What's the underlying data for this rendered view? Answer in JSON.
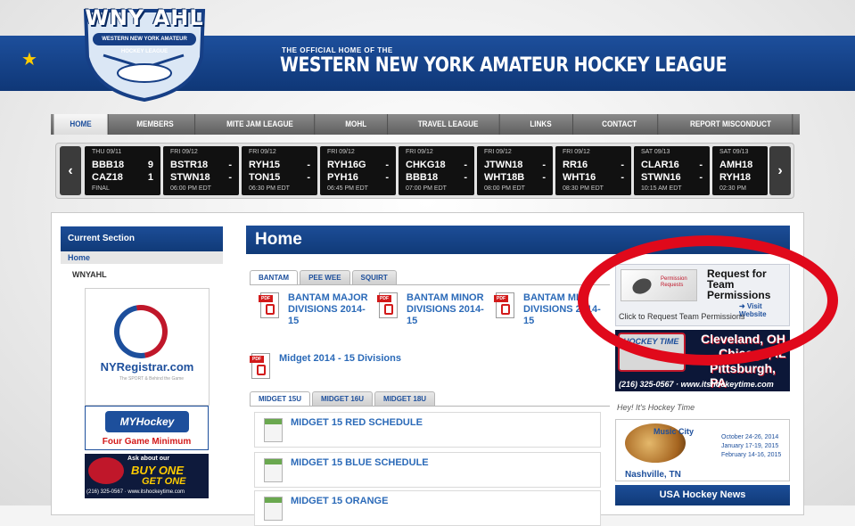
{
  "header": {
    "logo_text": "WNY AHL",
    "logo_subtext": "WESTERN NEW YORK AMATEUR HOCKEY LEAGUE",
    "official_small": "THE OFFICIAL HOME OF THE",
    "official_big": "WESTERN NEW YORK AMATEUR HOCKEY LEAGUE",
    "star_icon": "★"
  },
  "nav": {
    "items": [
      {
        "label": "HOME"
      },
      {
        "label": "MEMBERS"
      },
      {
        "label": "MITE JAM LEAGUE"
      },
      {
        "label": "MOHL"
      },
      {
        "label": "TRAVEL LEAGUE"
      },
      {
        "label": "LINKS"
      },
      {
        "label": "CONTACT"
      },
      {
        "label": "REPORT MISCONDUCT"
      }
    ]
  },
  "scoreboard": {
    "prev_label": "‹",
    "next_label": "›",
    "games": [
      {
        "date": "THU 09/11",
        "team1": "BBB18",
        "score1": "9",
        "team2": "CAZ18",
        "score2": "1",
        "status": "FINAL"
      },
      {
        "date": "FRI 09/12",
        "team1": "BSTR18",
        "score1": "-",
        "team2": "STWN18",
        "score2": "-",
        "status": "06:00 PM EDT"
      },
      {
        "date": "FRI 09/12",
        "team1": "RYH15",
        "score1": "-",
        "team2": "TON15",
        "score2": "-",
        "status": "06:30 PM EDT"
      },
      {
        "date": "FRI 09/12",
        "team1": "RYH16G",
        "score1": "-",
        "team2": "PYH16",
        "score2": "-",
        "status": "06:45 PM EDT"
      },
      {
        "date": "FRI 09/12",
        "team1": "CHKG18",
        "score1": "-",
        "team2": "BBB18",
        "score2": "-",
        "status": "07:00 PM EDT"
      },
      {
        "date": "FRI 09/12",
        "team1": "JTWN18",
        "score1": "-",
        "team2": "WHT18B",
        "score2": "-",
        "status": "08:00 PM EDT"
      },
      {
        "date": "FRI 09/12",
        "team1": "RR16",
        "score1": "-",
        "team2": "WHT16",
        "score2": "-",
        "status": "08:30 PM EDT"
      },
      {
        "date": "SAT 09/13",
        "team1": "CLAR16",
        "score1": "-",
        "team2": "STWN16",
        "score2": "-",
        "status": "10:15 AM EDT"
      },
      {
        "date": "SAT 09/13",
        "team1": "AMH18",
        "score1": "",
        "team2": "RYH18",
        "score2": "",
        "status": "02:30 PM"
      }
    ]
  },
  "sidebar": {
    "heading": "Current Section",
    "home_link": "Home",
    "section": "WNYAHL",
    "nyregistrar_text": "NYRegistrar.com",
    "nyregistrar_tagline": "The SPORT & Behind the Game",
    "myhockey_logo": "MYHockey TOURNAMENTS",
    "myhockey_footer": "Four Game Minimum",
    "htime_ask": "Ask about our",
    "htime_buy": "BUY ONE",
    "htime_get": "GET ONE",
    "htime_footer": "(216) 325-0567 · www.itshockeytime.com"
  },
  "main": {
    "title": "Home",
    "tabs1": [
      {
        "label": "BANTAM"
      },
      {
        "label": "PEE WEE"
      },
      {
        "label": "SQUIRT"
      }
    ],
    "pdf_links": [
      {
        "label": "BANTAM MAJOR DIVISIONS 2014-15"
      },
      {
        "label": "BANTAM MINOR DIVISIONS 2014-15"
      },
      {
        "label": "BANTAM MID DIVISIONS 2014-15"
      }
    ],
    "pdf_label": "PDF",
    "midget_pdf": "Midget 2014 - 15 Divisions",
    "tabs2": [
      {
        "label": "MIDGET 15U"
      },
      {
        "label": "MIDGET 16U"
      },
      {
        "label": "MIDGET 18U"
      }
    ],
    "schedules": [
      {
        "label": "MIDGET 15 RED SCHEDULE"
      },
      {
        "label": "MIDGET 15 BLUE SCHEDULE"
      },
      {
        "label": "MIDGET 15 ORANGE"
      }
    ]
  },
  "right_panel": {
    "permission_img_text": "Permission Requests",
    "permission_title": "Request for Team Permissions",
    "visit_link": "➜ Visit Website",
    "permission_caption": "Click to Request Team Permissions",
    "htime_logo": "HOCKEY TIME",
    "htime_city1": "Cleveland, OH",
    "htime_city2": "Chicago, IL",
    "htime_city3": "Pittsburgh, PA",
    "htime_phone": "(216) 325-0567 · www.itshockeytime.com",
    "hey_text": "Hey! It's Hockey Time",
    "music_title": "Music City",
    "music_dates": [
      "October 24-26, 2014",
      "January 17-19, 2015",
      "February 14-16, 2015"
    ],
    "music_city": "Nashville, TN",
    "usa_news": "USA Hockey News"
  },
  "colors": {
    "brand_blue": "#1d4f9c",
    "highlight_red": "#e0091b"
  }
}
